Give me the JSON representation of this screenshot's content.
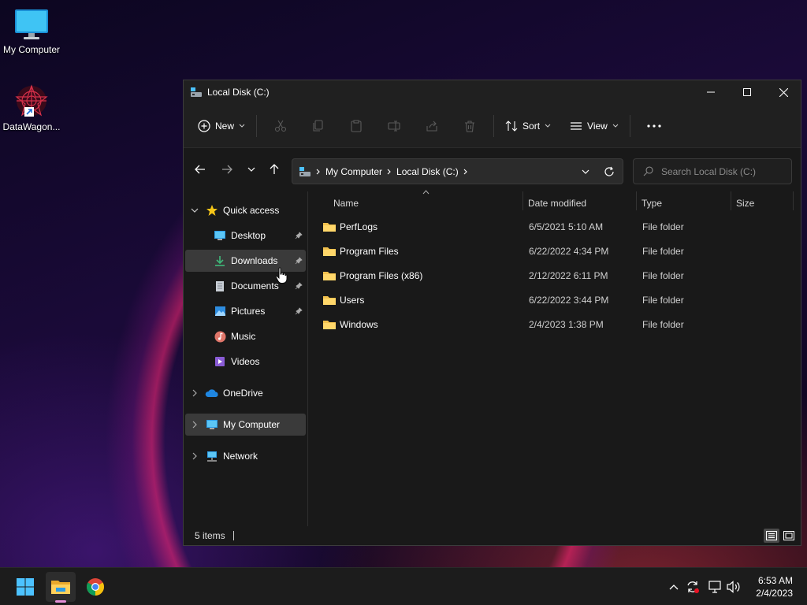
{
  "desktop": {
    "icons": [
      {
        "label": "My Computer",
        "icon": "monitor-icon"
      },
      {
        "label": "DataWagon...",
        "icon": "datawagon-shortcut-icon"
      }
    ]
  },
  "window": {
    "title": "Local Disk (C:)",
    "toolbar": {
      "new_label": "New",
      "sort_label": "Sort",
      "view_label": "View",
      "icons": [
        "cut-icon",
        "copy-icon",
        "paste-icon",
        "rename-icon",
        "share-icon",
        "delete-icon",
        "more-icon"
      ]
    },
    "address": {
      "path": [
        "My Computer",
        "Local Disk (C:)"
      ]
    },
    "search": {
      "placeholder": "Search Local Disk (C:)"
    },
    "nav": {
      "quick_access": "Quick access",
      "quick_items": [
        {
          "label": "Desktop",
          "icon": "desktop-icon",
          "pinned": true
        },
        {
          "label": "Downloads",
          "icon": "download-icon",
          "pinned": true
        },
        {
          "label": "Documents",
          "icon": "document-icon",
          "pinned": true
        },
        {
          "label": "Pictures",
          "icon": "pictures-icon",
          "pinned": true
        },
        {
          "label": "Music",
          "icon": "music-icon",
          "pinned": false
        },
        {
          "label": "Videos",
          "icon": "video-icon",
          "pinned": false
        }
      ],
      "onedrive": "OneDrive",
      "my_computer": "My Computer",
      "network": "Network"
    },
    "columns": {
      "name": "Name",
      "date": "Date modified",
      "type": "Type",
      "size": "Size"
    },
    "rows": [
      {
        "name": "PerfLogs",
        "date": "6/5/2021 5:10 AM",
        "type": "File folder"
      },
      {
        "name": "Program Files",
        "date": "6/22/2022 4:34 PM",
        "type": "File folder"
      },
      {
        "name": "Program Files (x86)",
        "date": "2/12/2022 6:11 PM",
        "type": "File folder"
      },
      {
        "name": "Users",
        "date": "6/22/2022 3:44 PM",
        "type": "File folder"
      },
      {
        "name": "Windows",
        "date": "2/4/2023 1:38 PM",
        "type": "File folder"
      }
    ],
    "status": {
      "items": "5 items"
    }
  },
  "taskbar": {
    "apps": [
      "start-icon",
      "file-explorer-icon",
      "chrome-icon"
    ],
    "tray": [
      "chevron-up-icon",
      "sync-icon",
      "network-icon",
      "volume-icon"
    ],
    "time": "6:53 AM",
    "date": "2/4/2023"
  },
  "colors": {
    "accent": "#4cc2ff",
    "folder": "#f2c14e",
    "selection": "#3a3a3a"
  }
}
